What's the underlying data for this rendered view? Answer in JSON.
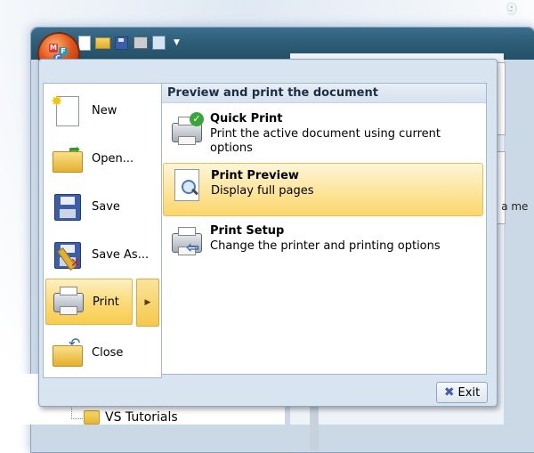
{
  "corner_number": "9",
  "behind_window": {
    "snippet": "e a me",
    "tree_item_label": "VS Tutorials"
  },
  "orb": {
    "letters": [
      "M",
      "F",
      "C"
    ]
  },
  "quick_access_toolbar": {
    "icons": [
      "new-icon",
      "open-icon",
      "save-icon",
      "print-icon",
      "copy-icon",
      "customize-dropdown-icon"
    ]
  },
  "app_menu": {
    "left_items": [
      {
        "label": "New",
        "icon": "new-document-icon"
      },
      {
        "label": "Open...",
        "icon": "open-folder-icon"
      },
      {
        "label": "Save",
        "icon": "floppy-disk-icon"
      },
      {
        "label": "Save As...",
        "icon": "save-as-icon"
      },
      {
        "label": "Print",
        "icon": "printer-icon",
        "selected": true
      },
      {
        "label": "Close",
        "icon": "close-folder-icon"
      }
    ],
    "right_panel": {
      "header": "Preview and print the document",
      "options": [
        {
          "title": "Quick Print",
          "desc": "Print the active document using current options",
          "icon": "quick-print-icon"
        },
        {
          "title": "Print Preview",
          "desc": "Display full pages",
          "icon": "print-preview-icon",
          "hover": true
        },
        {
          "title": "Print Setup",
          "desc": "Change the printer and printing options",
          "icon": "print-setup-icon"
        }
      ]
    },
    "exit_label": "Exit"
  },
  "colors": {
    "accent_hover": "#fbd66b",
    "menu_bg": "#d9e4f1",
    "titlebar": "#2f5f7a"
  }
}
